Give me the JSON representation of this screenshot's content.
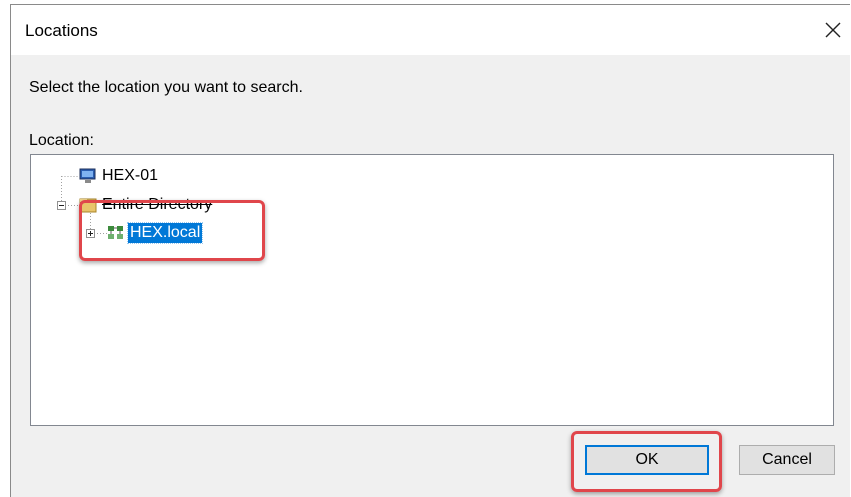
{
  "dialog": {
    "title": "Locations",
    "prompt": "Select the location you want to search.",
    "location_label": "Location:"
  },
  "tree": {
    "nodes": [
      {
        "label": "HEX-01",
        "icon": "computer-icon"
      },
      {
        "label": "Entire Directory",
        "icon": "directory-folder-icon"
      },
      {
        "label": "HEX.local",
        "icon": "domain-icon",
        "selected": true
      }
    ]
  },
  "buttons": {
    "ok_label": "OK",
    "cancel_label": "Cancel"
  },
  "colors": {
    "selection": "#0078d7",
    "annotation": "#e0464b",
    "dialog_bg": "#f0f0f0"
  }
}
